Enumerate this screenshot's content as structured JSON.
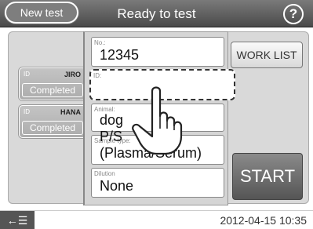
{
  "header": {
    "title": "Ready to test",
    "home_icon": "home-icon",
    "help_icon": "help-icon",
    "help_glyph": "?"
  },
  "sidebar": {
    "new_test_label": "New test",
    "patients": [
      {
        "id_label": "ID",
        "name": "JIRO",
        "status": "Completed"
      },
      {
        "id_label": "ID",
        "name": "HANA",
        "status": "Completed"
      }
    ]
  },
  "form": {
    "no_label": "No.:",
    "no_value": "12345",
    "id_label": "ID:",
    "id_value": "",
    "animal_label": "Animal:",
    "animal_value": "dog",
    "sample_label": "Sample type:",
    "sample_value": "P/S (Plasma/Serum)",
    "dilution_label": "Dilution",
    "dilution_value": "None"
  },
  "buttons": {
    "worklist_label": "WORK LIST",
    "start_label": "START"
  },
  "footer": {
    "back_glyph": "←☰",
    "datetime": "2012-04-15 10:35"
  },
  "colors": {
    "header_bg": "#5a5a5a",
    "panel_bg": "#d5d5d5",
    "start_bg": "#6a6a6a"
  }
}
